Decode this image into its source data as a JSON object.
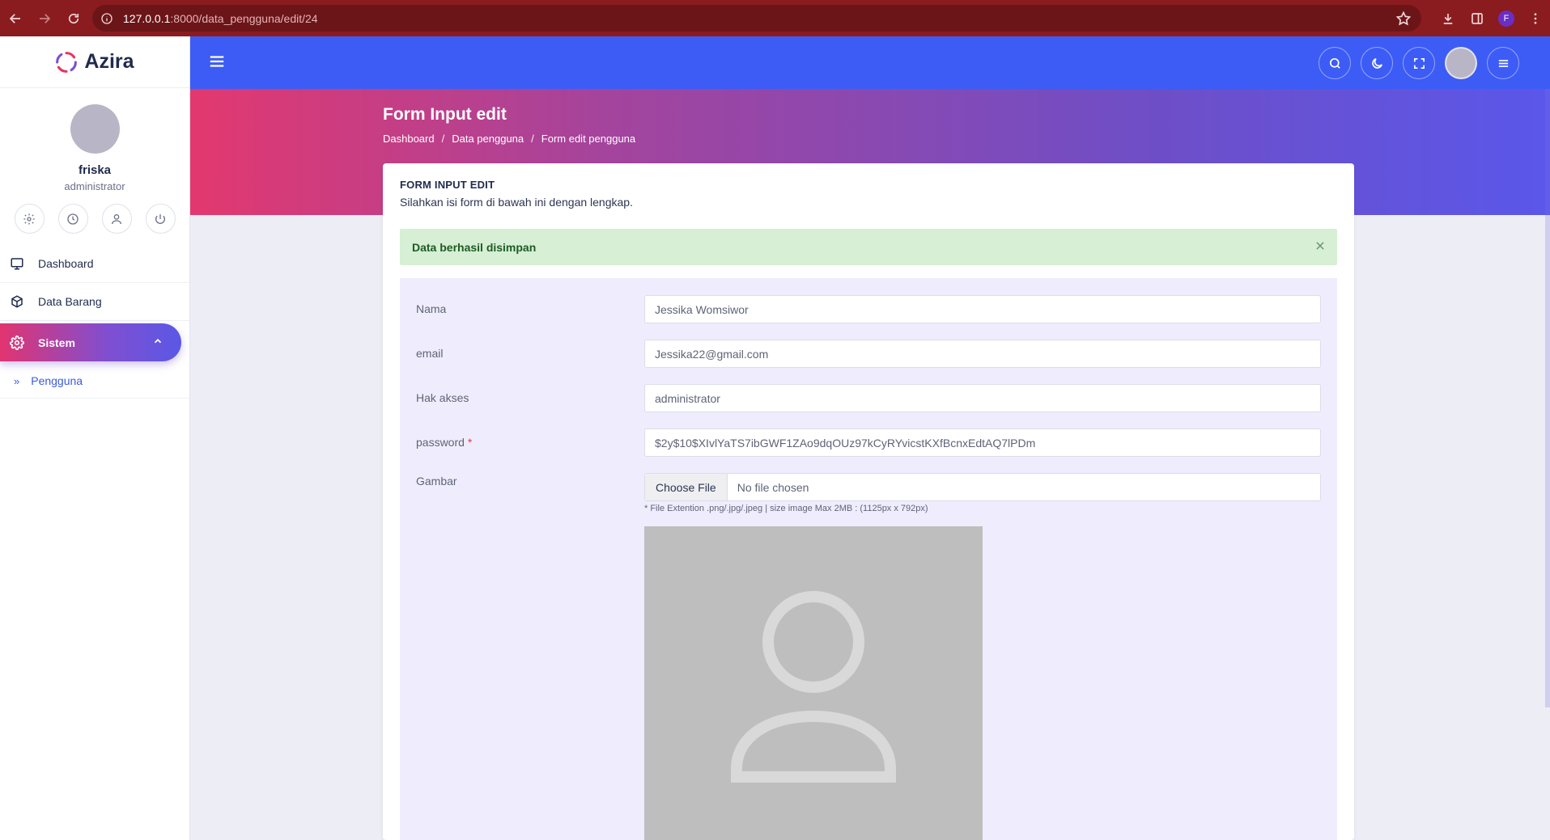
{
  "browser": {
    "url_host": "127.0.0.1",
    "url_rest": ":8000/data_pengguna/edit/24",
    "profile_initial": "F"
  },
  "brand": {
    "name": "Azira"
  },
  "user": {
    "name": "friska",
    "role": "administrator"
  },
  "sidebar": {
    "items": [
      {
        "label": "Dashboard",
        "icon": "monitor-icon"
      },
      {
        "label": "Data Barang",
        "icon": "box-icon"
      },
      {
        "label": "Sistem",
        "icon": "gear-icon",
        "active": true
      }
    ],
    "subitems": [
      {
        "label": "Pengguna",
        "prefix": "»"
      }
    ]
  },
  "header": {
    "title": "Form Input edit",
    "breadcrumb": [
      "Dashboard",
      "Data pengguna",
      "Form edit pengguna"
    ],
    "breadcrumb_sep": "/"
  },
  "card": {
    "title": "FORM INPUT EDIT",
    "subtitle": "Silahkan isi form di bawah ini dengan lengkap."
  },
  "alert": {
    "message": "Data berhasil disimpan",
    "color": "#d6efd5"
  },
  "form": {
    "nama": {
      "label": "Nama",
      "value": "Jessika Womsiwor"
    },
    "email": {
      "label": "email",
      "value": "Jessika22@gmail.com"
    },
    "hak_akses": {
      "label": "Hak akses",
      "value": "administrator"
    },
    "password": {
      "label": "password",
      "required_mark": "*",
      "value": "$2y$10$XIvlYaTS7ibGWF1ZAo9dqOUz97kCyRYvicstKXfBcnxEdtAQ7lPDm"
    },
    "gambar": {
      "label": "Gambar",
      "choose_label": "Choose File",
      "file_name": "No file chosen",
      "hint": "* File Extention .png/.jpg/.jpeg | size image Max 2MB : (1125px x 792px)"
    }
  },
  "colors": {
    "topbar": "#3d5cf5",
    "hero_start": "#e3386f",
    "hero_end": "#5a57ea",
    "browser_chrome": "#8a1c20"
  }
}
